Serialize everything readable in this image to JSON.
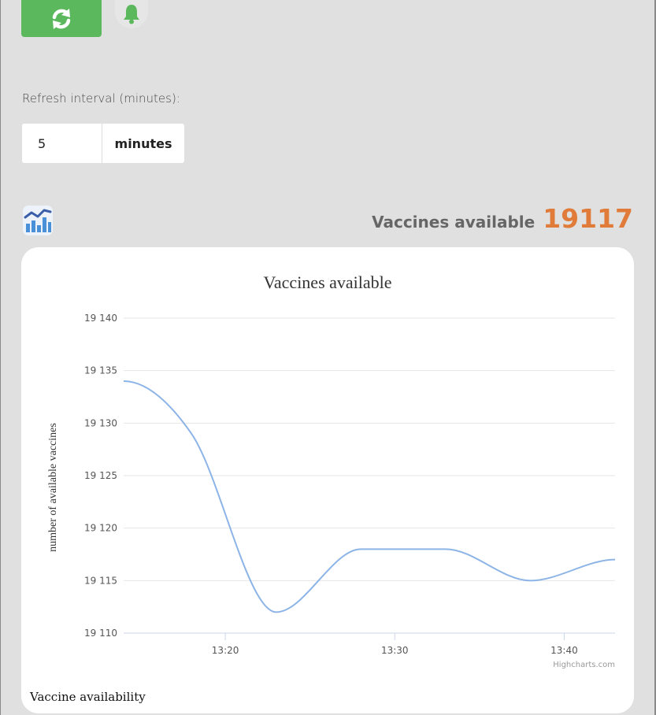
{
  "toolbar": {
    "refresh_icon": "refresh-icon",
    "bell_icon": "bell-icon",
    "accent": "#5cb85c"
  },
  "interval": {
    "label": "Refresh interval (minutes):",
    "value": "5",
    "unit": "minutes"
  },
  "summary": {
    "label": "Vaccines available",
    "count": "19117",
    "count_color": "#e07b39",
    "icon": "chart-icon"
  },
  "caption": "Vaccine availability",
  "credits": "Highcharts.com",
  "chart_data": {
    "type": "line",
    "title": "Vaccines available",
    "ylabel": "number of available vaccines",
    "xlabel": "",
    "x": [
      "13:14",
      "13:18",
      "13:23",
      "13:28",
      "13:33",
      "13:38",
      "13:43"
    ],
    "values": [
      19134,
      19129,
      19112,
      19118,
      19118,
      19115,
      19117
    ],
    "series": [
      {
        "values": [
          19134,
          19129,
          19112,
          19118,
          19118,
          19115,
          19117
        ],
        "color": "#8cb4e6"
      }
    ],
    "ylim": [
      19110,
      19140
    ],
    "yticks": [
      "19 110",
      "19 115",
      "19 120",
      "19 125",
      "19 130",
      "19 135",
      "19 140"
    ],
    "xticks": [
      "13:20",
      "13:30",
      "13:40"
    ],
    "grid": true,
    "legend": "none"
  }
}
